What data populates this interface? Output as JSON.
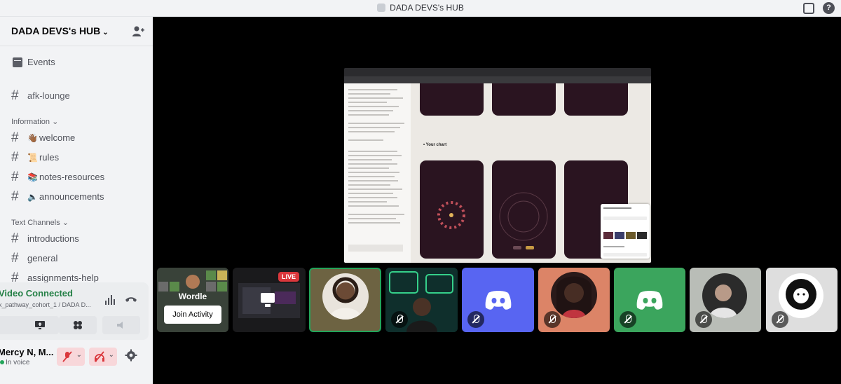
{
  "window": {
    "title": "DADA DEVS's HUB"
  },
  "server": {
    "name": "DADA DEVS's HUB",
    "chevron": "⌄"
  },
  "sidebar": {
    "events_label": "Events",
    "afk_channel": "afk-lounge",
    "categories": {
      "information": "Information ⌄",
      "text_channels": "Text Channels ⌄"
    },
    "info_channels": [
      {
        "emoji": "👋🏾",
        "label": "welcome"
      },
      {
        "emoji": "📜",
        "label": "rules"
      },
      {
        "emoji": "📚",
        "label": "notes-resources"
      },
      {
        "emoji": "🔈",
        "label": "announcements"
      }
    ],
    "text_channels": [
      {
        "label": "introductions"
      },
      {
        "label": "general"
      },
      {
        "label": "assignments-help"
      }
    ]
  },
  "voice": {
    "status": "Video Connected",
    "channel": "x_pathway_cohort_1 / DADA D..."
  },
  "user": {
    "name": "Mercy N, M...",
    "status": "In voice"
  },
  "stream": {
    "section_label": "• Your chart"
  },
  "tiles": {
    "wordle_label": "Wordle",
    "join_label": "Join Activity",
    "live_label": "LIVE"
  },
  "icons": [
    "invite-people-icon",
    "calendar-icon",
    "hash-icon",
    "voice-signal-icon",
    "hang-up-icon",
    "screen-share-icon",
    "activity-icon",
    "soundboard-icon",
    "mic-muted-icon",
    "headphones-muted-icon",
    "settings-gear-icon",
    "inbox-icon",
    "help-icon",
    "discord-logo-icon"
  ],
  "colors": {
    "connected_green": "#248046",
    "live_red": "#da373c",
    "discord_blurple": "#5865f2",
    "tile_salmon": "#dc8467",
    "tile_green": "#3ba55d"
  }
}
